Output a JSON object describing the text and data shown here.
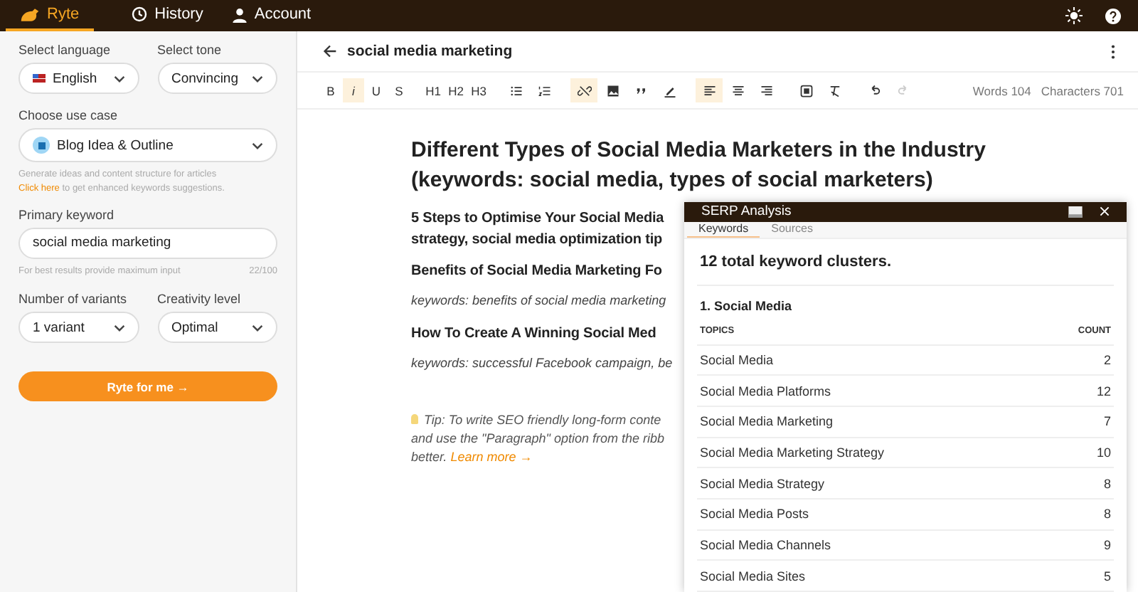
{
  "nav": {
    "tabs": [
      {
        "label": "Ryte",
        "kind": "logo",
        "selected": true
      },
      {
        "label": "History",
        "kind": "history",
        "selected": false
      },
      {
        "label": "Account",
        "kind": "account",
        "selected": false
      }
    ]
  },
  "sidebar": {
    "language": {
      "label": "Select language",
      "value": "English"
    },
    "tone": {
      "label": "Select tone",
      "value": "Convincing"
    },
    "use_case": {
      "label": "Choose use case",
      "value": "Blog Idea & Outline",
      "hint": "Generate ideas and content structure for articles",
      "link": "Click here",
      "link_rest": "to get enhanced keywords suggestions."
    },
    "keyword": {
      "label": "Primary keyword",
      "value": "social media marketing",
      "hint": "For best results provide maximum input",
      "counter": "22/100"
    },
    "variants": {
      "label": "Number of variants",
      "value": "1 variant"
    },
    "creativity": {
      "label": "Creativity level",
      "value": "Optimal"
    },
    "submit": "Ryte for me →"
  },
  "editor": {
    "title": "social media marketing",
    "toolbar": [
      [
        {
          "kind": "text",
          "label": "B",
          "selected": false
        },
        {
          "kind": "text",
          "label": "i",
          "selected": true
        },
        {
          "kind": "text",
          "label": "U",
          "selected": false
        },
        {
          "kind": "text",
          "label": "S",
          "selected": false
        }
      ],
      [
        {
          "kind": "text",
          "label": "H1",
          "selected": false
        },
        {
          "kind": "text",
          "label": "H2",
          "selected": false
        },
        {
          "kind": "text",
          "label": "H3",
          "selected": false
        }
      ],
      [
        {
          "kind": "bulletlist",
          "selected": false
        },
        {
          "kind": "numberlist",
          "selected": false
        }
      ],
      [
        {
          "kind": "unlink",
          "selected": true
        },
        {
          "kind": "image",
          "selected": false
        },
        {
          "kind": "quote",
          "selected": false
        },
        {
          "kind": "pen",
          "selected": false
        }
      ],
      [
        {
          "kind": "alignleft",
          "selected": true
        },
        {
          "kind": "aligncenter",
          "selected": false
        },
        {
          "kind": "alignright",
          "selected": false
        }
      ],
      [
        {
          "kind": "embed",
          "selected": false
        },
        {
          "kind": "clearformat",
          "selected": false
        }
      ],
      [
        {
          "kind": "undo",
          "disabled": false
        },
        {
          "kind": "redo",
          "disabled": true
        }
      ]
    ],
    "words": "Words 104",
    "characters": "Characters 701",
    "blocks": [
      {
        "kind": "h1",
        "lines": [
          "Different Types of Social Media Marketers in the Industry",
          "(keywords: social media, types of social marketers)"
        ]
      },
      {
        "kind": "h2",
        "lines": [
          "5 Steps to Optimise Your Social Media",
          "strategy, social media optimization tip"
        ]
      },
      {
        "kind": "h2",
        "lines": [
          "Benefits of Social Media Marketing Fo"
        ]
      },
      {
        "kind": "keywords",
        "lines": [
          "keywords: benefits of social media marketing"
        ]
      },
      {
        "kind": "h2",
        "lines": [
          "How To Create A Winning Social Med"
        ]
      },
      {
        "kind": "keywords",
        "lines": [
          "keywords: successful Facebook campaign, be"
        ]
      }
    ],
    "tip": {
      "lines": [
        "Tip: To write SEO friendly long-form conte",
        "and use the \"Paragraph\" option from the ribb",
        "better."
      ],
      "link": "Learn more →"
    }
  },
  "serp": {
    "title": "SERP Analysis",
    "tabs": [
      {
        "label": "Keywords",
        "selected": true
      },
      {
        "label": "Sources",
        "selected": false
      }
    ],
    "summary": "12 total keyword clusters.",
    "cluster": "1. Social Media",
    "columns": [
      "TOPICS",
      "COUNT"
    ],
    "rows": [
      {
        "topic": "Social Media",
        "count": "2"
      },
      {
        "topic": "Social Media Platforms",
        "count": "12"
      },
      {
        "topic": "Social Media Marketing",
        "count": "7"
      },
      {
        "topic": "Social Media Marketing Strategy",
        "count": "10"
      },
      {
        "topic": "Social Media Strategy",
        "count": "8"
      },
      {
        "topic": "Social Media Posts",
        "count": "8"
      },
      {
        "topic": "Social Media Channels",
        "count": "9"
      },
      {
        "topic": "Social Media Sites",
        "count": "5"
      }
    ]
  }
}
